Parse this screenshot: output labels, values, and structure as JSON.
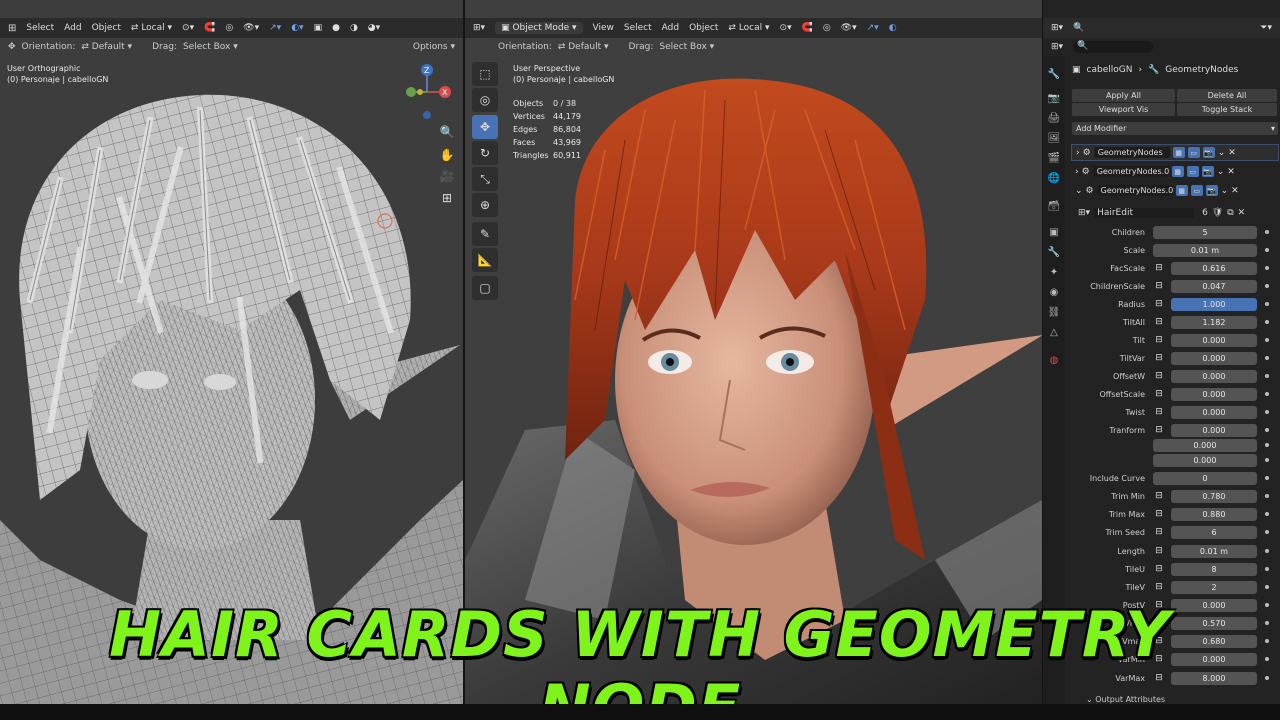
{
  "left_header": {
    "items": [
      "Select",
      "Add",
      "Object"
    ],
    "transform": "Local"
  },
  "left_header2": {
    "orientation_label": "Orientation:",
    "orientation_value": "Default",
    "drag_label": "Drag:",
    "drag_value": "Select Box",
    "options": "Options"
  },
  "left_view": {
    "view_name": "User Orthographic",
    "collection": "(0) Personaje | cabelloGN"
  },
  "mid_header": {
    "mode": "Object Mode",
    "items": [
      "View",
      "Select",
      "Add",
      "Object"
    ],
    "transform": "Local"
  },
  "mid_header2": {
    "orientation_label": "Orientation:",
    "orientation_value": "Default",
    "drag_label": "Drag:",
    "drag_value": "Select Box"
  },
  "mid_view": {
    "view_name": "User Perspective",
    "collection": "(0) Personaje | cabelloGN"
  },
  "stats": [
    {
      "label": "Objects",
      "value": "0 / 38"
    },
    {
      "label": "Vertices",
      "value": "44,179"
    },
    {
      "label": "Edges",
      "value": "86,804"
    },
    {
      "label": "Faces",
      "value": "43,969"
    },
    {
      "label": "Triangles",
      "value": "60,911"
    }
  ],
  "properties": {
    "object_name": "cabelloGN",
    "modifier_name": "GeometryNodes",
    "apply_all": "Apply All",
    "delete_all": "Delete All",
    "viewport_vis": "Viewport Vis",
    "toggle_stack": "Toggle Stack",
    "add_modifier": "Add Modifier",
    "modifiers": [
      "GeometryNodes",
      "GeometryNodes.0...",
      "GeometryNodes.0..."
    ],
    "node_group": "HairEdit",
    "node_users": "6",
    "output_attributes": "Output Attributes",
    "params": [
      {
        "label": "Children",
        "value": "5",
        "socket": false,
        "selected": false
      },
      {
        "label": "Scale",
        "value": "0.01 m",
        "socket": false,
        "selected": false
      },
      {
        "label": "FacScale",
        "value": "0.616",
        "socket": true,
        "selected": false
      },
      {
        "label": "ChildrenScale",
        "value": "0.047",
        "socket": true,
        "selected": false
      },
      {
        "label": "Radius",
        "value": "1.000",
        "socket": true,
        "selected": true
      },
      {
        "label": "TiltAll",
        "value": "1.182",
        "socket": true,
        "selected": false
      },
      {
        "label": "Tilt",
        "value": "0.000",
        "socket": true,
        "selected": false
      },
      {
        "label": "TiltVar",
        "value": "0.000",
        "socket": true,
        "selected": false
      },
      {
        "label": "OffsetW",
        "value": "0.000",
        "socket": true,
        "selected": false
      },
      {
        "label": "OffsetScale",
        "value": "0.000",
        "socket": true,
        "selected": false
      },
      {
        "label": "Twist",
        "value": "0.000",
        "socket": true,
        "selected": false
      },
      {
        "label": "Tranform",
        "value": "0.000",
        "socket": true,
        "selected": false
      },
      {
        "label": "",
        "value": "0.000",
        "socket": false,
        "selected": false
      },
      {
        "label": "",
        "value": "0.000",
        "socket": false,
        "selected": false
      },
      {
        "label": "Include Curve",
        "value": "0",
        "socket": false,
        "selected": false
      },
      {
        "label": "Trim Min",
        "value": "0.780",
        "socket": true,
        "selected": false
      },
      {
        "label": "Trim Max",
        "value": "0.880",
        "socket": true,
        "selected": false
      },
      {
        "label": "Trim Seed",
        "value": "6",
        "socket": true,
        "selected": false
      },
      {
        "label": "Length",
        "value": "0.01 m",
        "socket": true,
        "selected": false
      },
      {
        "label": "TileU",
        "value": "8",
        "socket": true,
        "selected": false
      },
      {
        "label": "TileV",
        "value": "2",
        "socket": true,
        "selected": false
      },
      {
        "label": "PostV",
        "value": "0.000",
        "socket": true,
        "selected": false
      },
      {
        "label": "Vmin",
        "value": "0.570",
        "socket": true,
        "selected": false
      },
      {
        "label": "Vmax",
        "value": "0.680",
        "socket": true,
        "selected": false
      },
      {
        "label": "VarMin",
        "value": "0.000",
        "socket": true,
        "selected": false
      },
      {
        "label": "VarMax",
        "value": "8.000",
        "socket": true,
        "selected": false
      }
    ]
  },
  "overlay_title": "HAIR CARDS WITH GEOMETRY NODE",
  "colors": {
    "accent": "#4772b3",
    "title_green": "#7ef41a",
    "hair_orange": "#b6421c"
  }
}
